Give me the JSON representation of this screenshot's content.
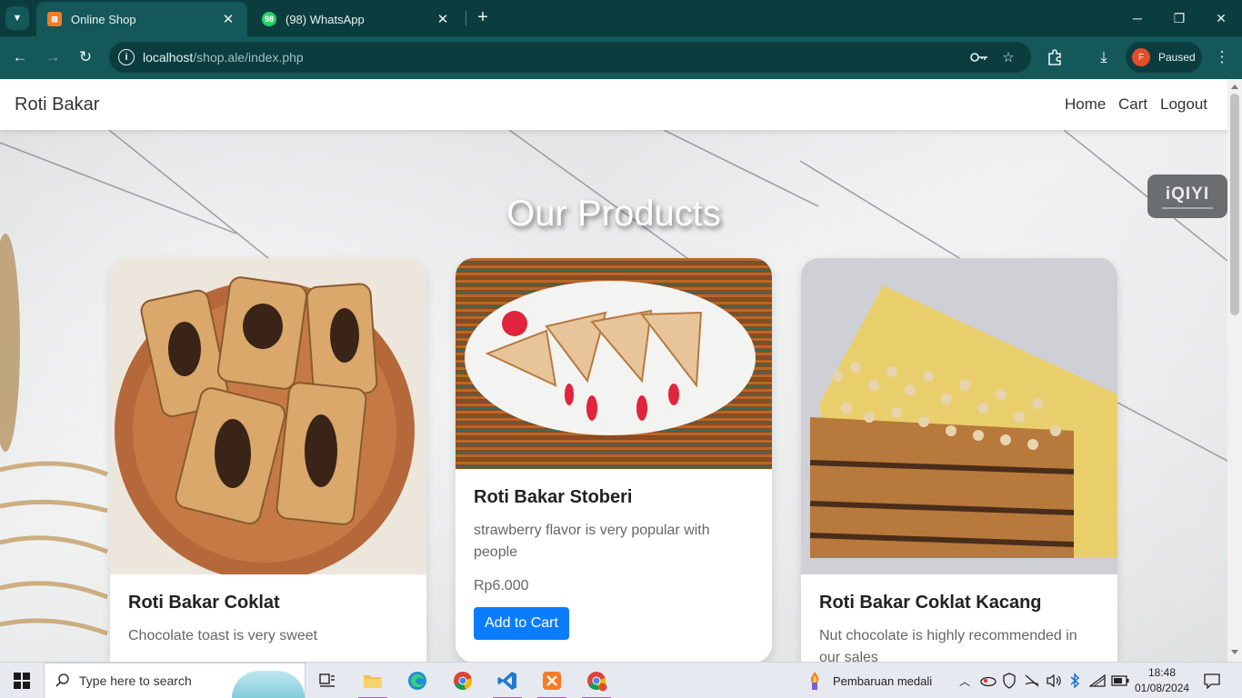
{
  "browser": {
    "tabs": [
      {
        "title": "Online Shop",
        "active": true,
        "favicon": "xampp-icon"
      },
      {
        "title": "(98) WhatsApp",
        "active": false,
        "favicon": "whatsapp-icon",
        "badge": "98"
      }
    ],
    "url_host": "localhost",
    "url_path": "/shop.ale/index.php",
    "profile_initial": "F",
    "profile_status": "Paused"
  },
  "site": {
    "brand": "Roti Bakar",
    "nav": [
      "Home",
      "Cart",
      "Logout"
    ],
    "heading": "Our Products",
    "overlay_logo": "iQIYI"
  },
  "products": [
    {
      "name": "Roti Bakar Coklat",
      "description": "Chocolate toast is very sweet",
      "image": "chocolate-toast-photo"
    },
    {
      "name": "Roti Bakar Stoberi",
      "description": "strawberry flavor is very popular with people",
      "price": "Rp6.000",
      "button": "Add to Cart",
      "image": "strawberry-toast-photo"
    },
    {
      "name": "Roti Bakar Coklat Kacang",
      "description": "Nut chocolate is highly recommended in our sales",
      "image": "nut-chocolate-toast-photo"
    }
  ],
  "taskbar": {
    "search_placeholder": "Type here to search",
    "news": "Pembaruan medali",
    "time": "18:48",
    "date": "01/08/2024"
  },
  "colors": {
    "chrome_dark": "#0b3d3f",
    "chrome_toolbar": "#14585a",
    "button_primary": "#0a7cff"
  }
}
